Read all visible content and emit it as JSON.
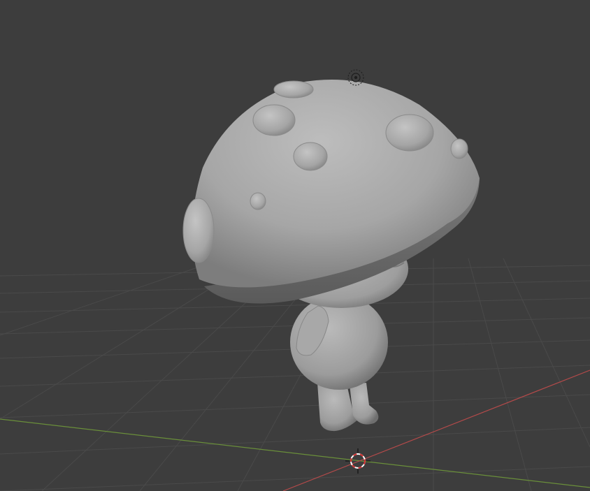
{
  "viewport": {
    "background_color": "#3d3d3d",
    "grid_color": "#4a4a4a",
    "x_axis_color": "#b34a4a",
    "y_axis_color": "#6a8f3a",
    "model_base_color": "#a3a3a3",
    "model_shadow_color": "#6e6e6e",
    "model_highlight_color": "#c9c9c9",
    "cursor_icon": "3d-cursor-icon",
    "light_icon": "light-object-icon"
  }
}
